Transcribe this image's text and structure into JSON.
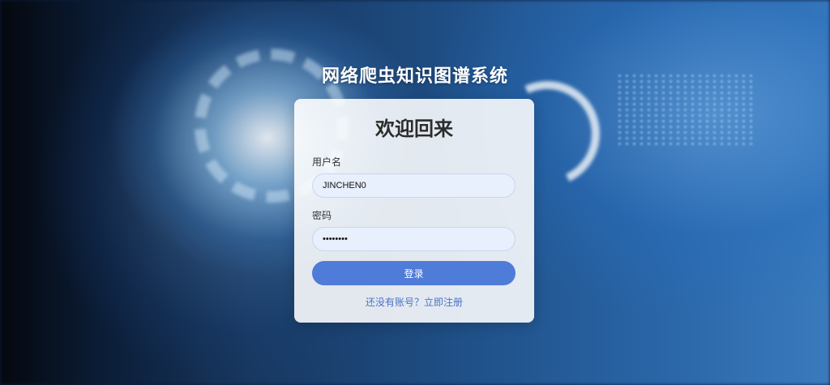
{
  "site": {
    "title": "网络爬虫知识图谱系统"
  },
  "login": {
    "heading": "欢迎回来",
    "username_label": "用户名",
    "username_value": "JINCHEN0",
    "password_label": "密码",
    "password_value": "••••••••",
    "submit_label": "登录",
    "register_prompt": "还没有账号？立即注册"
  },
  "colors": {
    "accent": "#4f7bd9",
    "link": "#4a72c9",
    "input_bg": "#e8effd"
  }
}
